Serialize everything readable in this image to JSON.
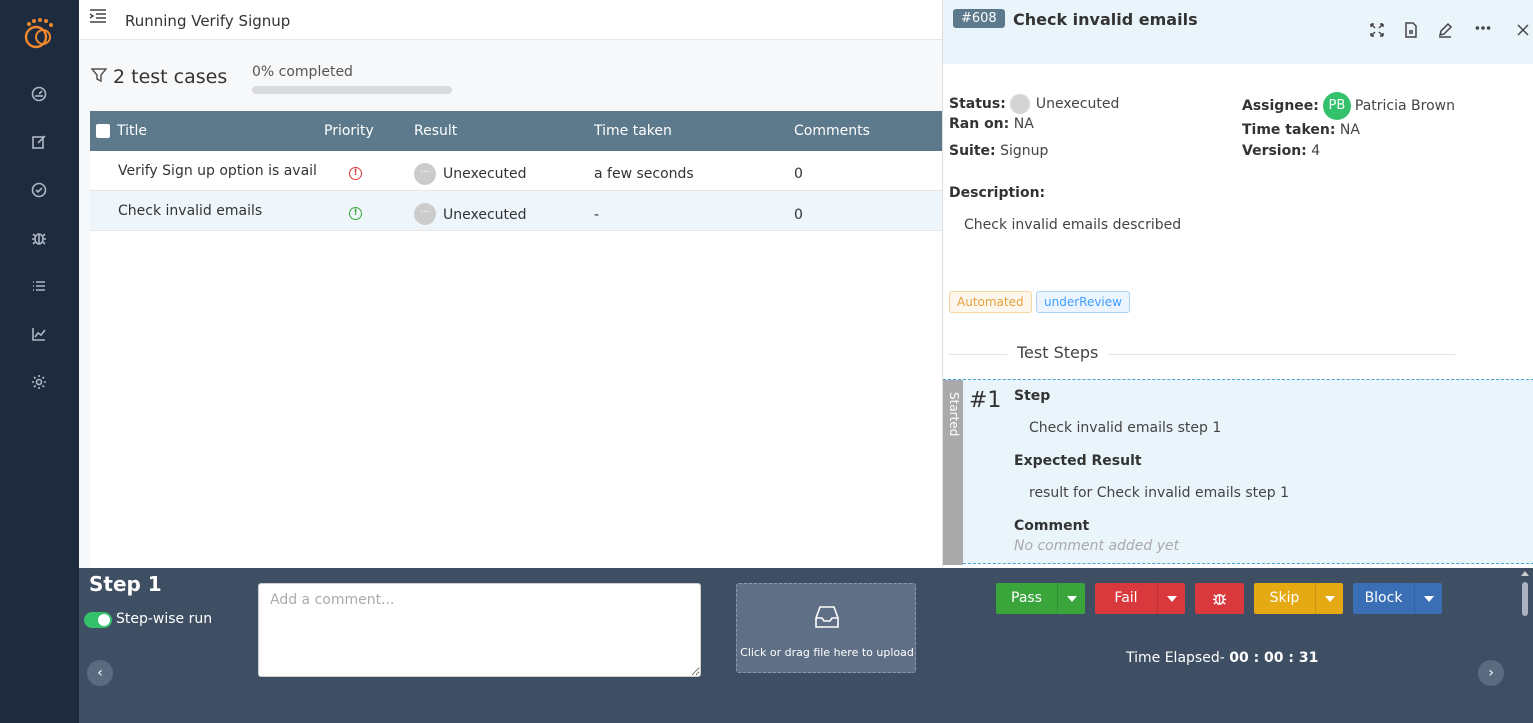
{
  "header": {
    "run_title": "Running Verify Signup"
  },
  "summary": {
    "case_count_text": "2 test cases",
    "completion_text": "0% completed",
    "progress_fraction": 0
  },
  "table": {
    "columns": [
      "Title",
      "Priority",
      "Result",
      "Time taken",
      "Comments"
    ],
    "rows": [
      {
        "title": "Verify Sign up option is avail",
        "priority": "high",
        "result": "Unexecuted",
        "time_taken": "a few seconds",
        "comments": "0"
      },
      {
        "title": "Check invalid emails",
        "priority": "low",
        "result": "Unexecuted",
        "time_taken": "-",
        "comments": "0"
      }
    ]
  },
  "detail": {
    "case_id": "#608",
    "title": "Check invalid emails",
    "status_label": "Status:",
    "status_value": "Unexecuted",
    "ran_on_label": "Ran on:",
    "ran_on_value": "NA",
    "suite_label": "Suite:",
    "suite_value": "Signup",
    "assignee_label": "Assignee:",
    "assignee_initials": "PB",
    "assignee_name": "Patricia Brown",
    "time_taken_label": "Time taken:",
    "time_taken_value": "NA",
    "version_label": "Version:",
    "version_value": "4",
    "description_label": "Description:",
    "description_text": "Check invalid emails described",
    "tags": [
      "Automated",
      "underReview"
    ],
    "steps_title": "Test Steps",
    "step": {
      "status": "Started",
      "number": "#1",
      "step_label": "Step",
      "step_text": "Check invalid emails step 1",
      "expected_label": "Expected Result",
      "expected_text": "result for Check invalid emails step 1",
      "comment_label": "Comment",
      "comment_empty": "No comment added yet"
    }
  },
  "bottom": {
    "step_heading": "Step 1",
    "stepwise_label": "Step-wise run",
    "comment_placeholder": "Add a comment...",
    "upload_text": "Click or drag file here to upload",
    "buttons": {
      "pass": "Pass",
      "fail": "Fail",
      "skip": "Skip",
      "block": "Block"
    },
    "elapsed_label": "Time Elapsed-",
    "elapsed_value": "00 : 00 : 31"
  },
  "colors": {
    "sidebar": "#1e2a3d",
    "table_header": "#5c7a8c",
    "pass": "#3aa53a",
    "fail": "#d9393c",
    "skip": "#e5a913",
    "block": "#3b6fb5"
  },
  "icons": {
    "sidebar": [
      "dashboard-icon",
      "edit-icon",
      "check-circle-icon",
      "bug-icon",
      "list-icon",
      "chart-icon",
      "gear-icon"
    ]
  }
}
